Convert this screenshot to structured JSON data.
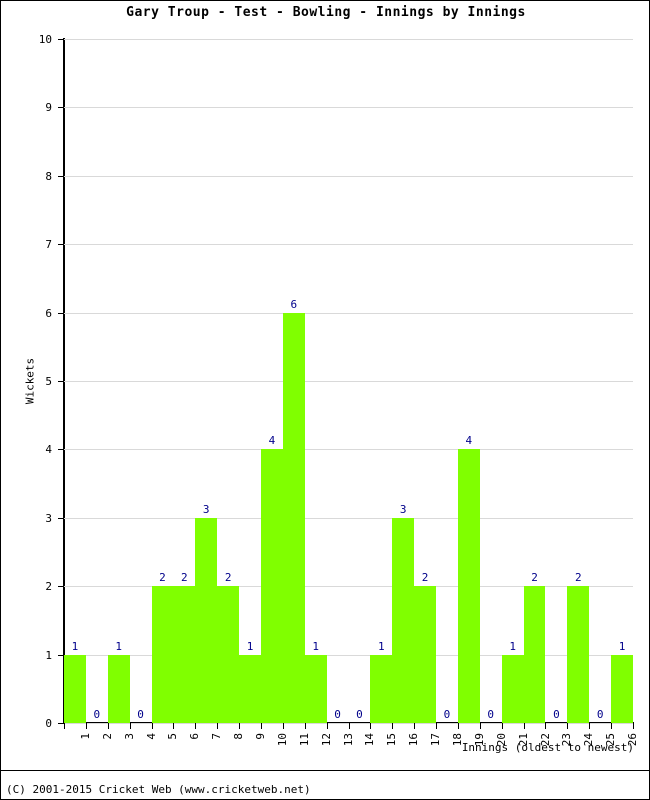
{
  "chart_data": {
    "type": "bar",
    "title": "Gary Troup - Test - Bowling - Innings by Innings",
    "xlabel": "Innings (oldest to newest)",
    "ylabel": "Wickets",
    "categories": [
      "1",
      "2",
      "3",
      "4",
      "5",
      "6",
      "7",
      "8",
      "9",
      "10",
      "11",
      "12",
      "13",
      "14",
      "15",
      "16",
      "17",
      "18",
      "19",
      "20",
      "21",
      "22",
      "23",
      "24",
      "25",
      "26"
    ],
    "values": [
      1,
      0,
      1,
      0,
      2,
      2,
      3,
      2,
      1,
      4,
      6,
      1,
      0,
      0,
      1,
      3,
      2,
      0,
      4,
      0,
      1,
      2,
      0,
      2,
      0,
      1
    ],
    "data_labels": [
      "1",
      "0",
      "1",
      "0",
      "2",
      "2",
      "3",
      "2",
      "1",
      "4",
      "6",
      "1",
      "0",
      "0",
      "1",
      "3",
      "2",
      "0",
      "4",
      "0",
      "1",
      "2",
      "0",
      "2",
      "0",
      "1"
    ],
    "ylim": [
      0,
      10
    ],
    "yticks": [
      "0",
      "1",
      "2",
      "3",
      "4",
      "5",
      "6",
      "7",
      "8",
      "9",
      "10"
    ],
    "grid": true,
    "legend": "none",
    "bar_color": "#80ff00",
    "label_color": "#00008b",
    "axis_color": "#000000",
    "grid_color": "#d9d9d9"
  },
  "footer": {
    "copyright": "(C) 2001-2015 Cricket Web (www.cricketweb.net)"
  }
}
